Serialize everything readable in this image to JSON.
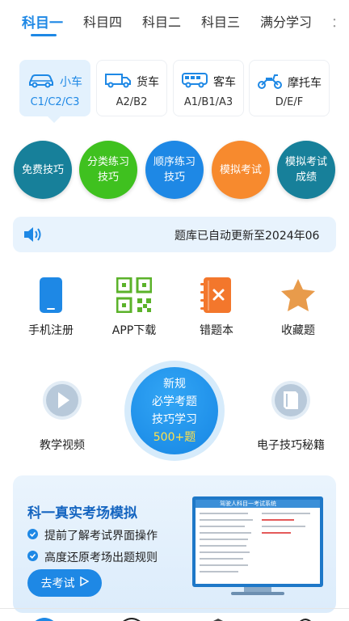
{
  "tabs": [
    {
      "label": "科目一",
      "active": true
    },
    {
      "label": "科目四",
      "active": false
    },
    {
      "label": "科目二",
      "active": false
    },
    {
      "label": "科目三",
      "active": false
    },
    {
      "label": "满分学习",
      "active": false
    },
    {
      "label": "：",
      "active": false
    }
  ],
  "vehicles": [
    {
      "name": "小车",
      "sub": "C1/C2/C3",
      "icon": "car-icon",
      "active": true
    },
    {
      "name": "货车",
      "sub": "A2/B2",
      "icon": "truck-icon",
      "active": false
    },
    {
      "name": "客车",
      "sub": "A1/B1/A3",
      "icon": "bus-icon",
      "active": false
    },
    {
      "name": "摩托车",
      "sub": "D/E/F",
      "icon": "motorcycle-icon",
      "active": false
    }
  ],
  "circles": [
    {
      "label": "免费技巧",
      "color": "#17809a"
    },
    {
      "label": "分类练习技巧",
      "color": "#3fc11f"
    },
    {
      "label": "顺序练习技巧",
      "color": "#1e88e5"
    },
    {
      "label": "模拟考试",
      "color": "#f78a2e"
    },
    {
      "label": "模拟考试成绩",
      "color": "#17809a"
    }
  ],
  "notice": {
    "text": "题库已自动更新至2024年06"
  },
  "quick": [
    {
      "label": "手机注册",
      "icon": "phone-icon"
    },
    {
      "label": "APP下载",
      "icon": "qrcode-icon"
    },
    {
      "label": "错题本",
      "icon": "wrong-book-icon"
    },
    {
      "label": "收藏题",
      "icon": "star-icon"
    }
  ],
  "middle": {
    "left_label": "教学视频",
    "right_label": "电子技巧秘籍",
    "center_lines": [
      "新规",
      "必学考题",
      "技巧学习"
    ],
    "center_count": "500+题"
  },
  "banner": {
    "title": "科一真实考场模拟",
    "points": [
      "提前了解考试界面操作",
      "高度还原考场出题规则"
    ],
    "button": "去考试",
    "screen_title": "驾驶人科目一考试系统"
  },
  "colors": {
    "accent": "#1E88E5",
    "active_card": "#e3f1fd"
  }
}
